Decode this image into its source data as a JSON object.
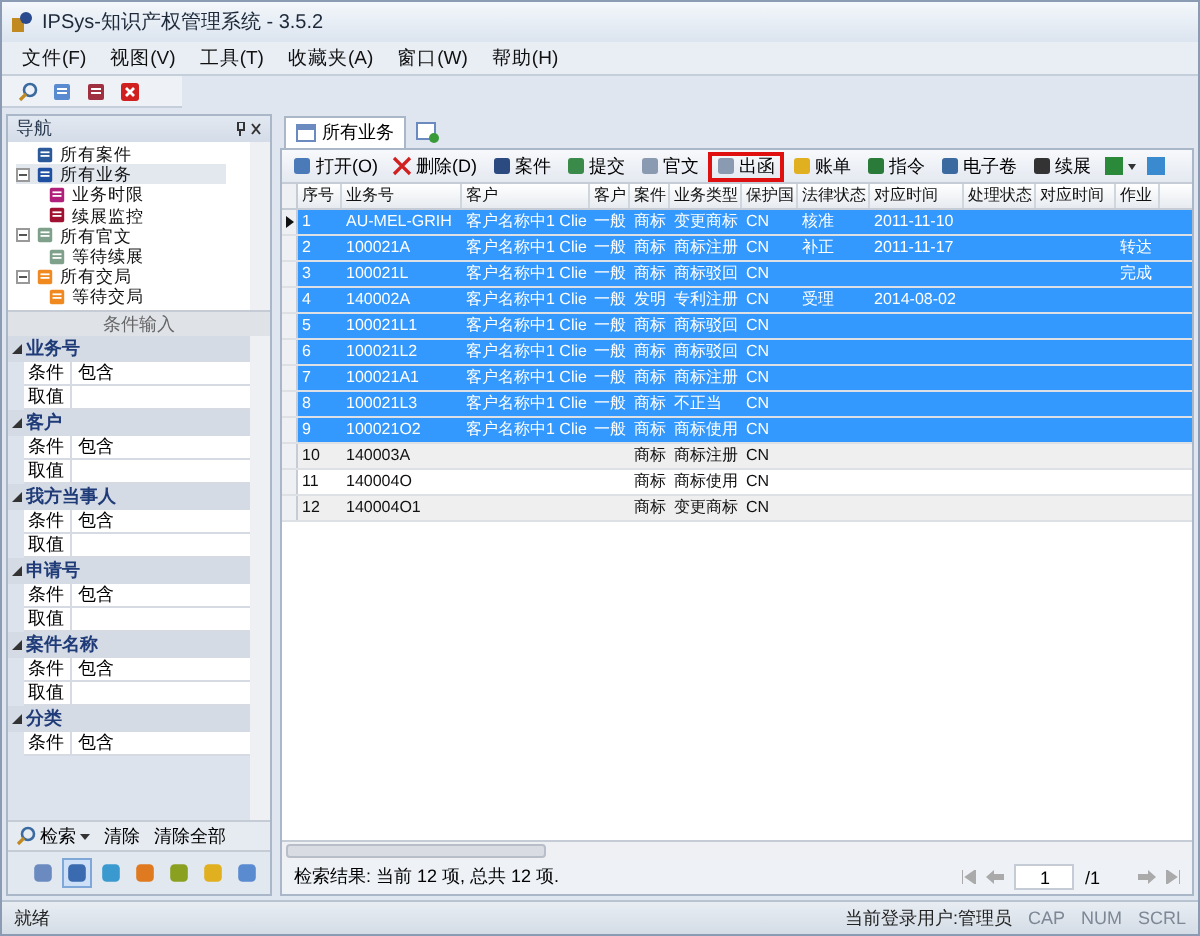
{
  "window": {
    "title": "IPSys-知识产权管理系统 - 3.5.2"
  },
  "menu": [
    "文件(F)",
    "视图(V)",
    "工具(T)",
    "收藏夹(A)",
    "窗口(W)",
    "帮助(H)"
  ],
  "navigation": {
    "title": "导航",
    "tree": [
      {
        "label": "所有案件",
        "selected": false
      },
      {
        "label": "所有业务",
        "selected": true,
        "expanded": true,
        "children": [
          {
            "label": "业务时限",
            "selected": false
          },
          {
            "label": "续展监控",
            "selected": false
          }
        ]
      },
      {
        "label": "所有官文",
        "selected": false,
        "expanded": true,
        "children": [
          {
            "label": "等待续展",
            "selected": false
          }
        ]
      },
      {
        "label": "所有交局",
        "selected": false,
        "expanded": true,
        "children": [
          {
            "label": "等待交局",
            "selected": false
          }
        ]
      }
    ]
  },
  "conditions": {
    "title": "条件输入",
    "groups": [
      {
        "name": "业务号",
        "expanded": true,
        "rows": [
          {
            "label": "条件",
            "value": "包含"
          },
          {
            "label": "取值"
          }
        ]
      },
      {
        "name": "客户",
        "expanded": true,
        "rows": [
          {
            "label": "条件",
            "value": "包含"
          },
          {
            "label": "取值"
          }
        ]
      },
      {
        "name": "我方当事人",
        "expanded": true,
        "rows": [
          {
            "label": "条件",
            "value": "包含"
          },
          {
            "label": "取值"
          }
        ]
      },
      {
        "name": "申请号",
        "expanded": true,
        "rows": [
          {
            "label": "条件",
            "value": "包含"
          },
          {
            "label": "取值"
          }
        ]
      },
      {
        "name": "案件名称",
        "expanded": true,
        "rows": [
          {
            "label": "条件",
            "value": "包含"
          },
          {
            "label": "取值"
          }
        ]
      },
      {
        "name": "分类",
        "expanded": true,
        "rows": [
          {
            "label": "条件",
            "value": "包含"
          }
        ]
      }
    ],
    "actions": [
      "检索",
      "清除",
      "清除全部"
    ]
  },
  "nav_buttons": [
    {
      "selected": false
    },
    {
      "selected": true
    },
    {
      "selected": false
    },
    {
      "selected": false
    },
    {
      "selected": false
    },
    {
      "selected": false
    },
    {
      "selected": false
    }
  ],
  "tabs": [
    {
      "label": "所有业务",
      "selected": true
    }
  ],
  "toolbar": [
    {
      "label": "打开(O)",
      "highlighted": false
    },
    {
      "label": "删除(D)",
      "highlighted": false
    },
    {
      "label": "案件",
      "highlighted": false
    },
    {
      "label": "提交",
      "highlighted": false
    },
    {
      "label": "官文",
      "highlighted": false
    },
    {
      "label": "出函",
      "highlighted": true
    },
    {
      "label": "账单",
      "highlighted": false
    },
    {
      "label": "指令",
      "highlighted": false
    },
    {
      "label": "电子卷",
      "highlighted": false
    },
    {
      "label": "续展",
      "highlighted": false
    }
  ],
  "table": {
    "columns": [
      "序号",
      "业务号",
      "客户",
      "客户",
      "案件",
      "业务类型",
      "保护国",
      "法律状态",
      "对应时间",
      "处理状态",
      "对应时间",
      "作业"
    ],
    "rows": [
      {
        "cells": [
          "1",
          "AU-MEL-GRIH",
          "客户名称中1 Clie",
          "一般",
          "商标",
          "变更商标",
          "CN",
          "核准",
          "2011-11-10",
          "",
          "",
          ""
        ],
        "selected": true,
        "current": true
      },
      {
        "cells": [
          "2",
          "100021A",
          "客户名称中1 Clie",
          "一般",
          "商标",
          "商标注册",
          "CN",
          "补正",
          "2011-11-17",
          "",
          "",
          "转达"
        ],
        "selected": true,
        "current": false
      },
      {
        "cells": [
          "3",
          "100021L",
          "客户名称中1 Clie",
          "一般",
          "商标",
          "商标驳回",
          "CN",
          "",
          "",
          "",
          "",
          "完成"
        ],
        "selected": true,
        "current": false
      },
      {
        "cells": [
          "4",
          "140002A",
          "客户名称中1 Clie",
          "一般",
          "发明",
          "专利注册",
          "CN",
          "受理",
          "2014-08-02",
          "",
          "",
          ""
        ],
        "selected": true,
        "current": false
      },
      {
        "cells": [
          "5",
          "100021L1",
          "客户名称中1 Clie",
          "一般",
          "商标",
          "商标驳回",
          "CN",
          "",
          "",
          "",
          "",
          ""
        ],
        "selected": true,
        "current": false
      },
      {
        "cells": [
          "6",
          "100021L2",
          "客户名称中1 Clie",
          "一般",
          "商标",
          "商标驳回",
          "CN",
          "",
          "",
          "",
          "",
          ""
        ],
        "selected": true,
        "current": false
      },
      {
        "cells": [
          "7",
          "100021A1",
          "客户名称中1 Clie",
          "一般",
          "商标",
          "商标注册",
          "CN",
          "",
          "",
          "",
          "",
          ""
        ],
        "selected": true,
        "current": false
      },
      {
        "cells": [
          "8",
          "100021L3",
          "客户名称中1 Clie",
          "一般",
          "商标",
          "不正当",
          "CN",
          "",
          "",
          "",
          "",
          ""
        ],
        "selected": true,
        "current": false
      },
      {
        "cells": [
          "9",
          "100021O2",
          "客户名称中1 Clie",
          "一般",
          "商标",
          "商标使用",
          "CN",
          "",
          "",
          "",
          "",
          ""
        ],
        "selected": true,
        "current": false
      },
      {
        "cells": [
          "10",
          "140003A",
          "",
          "",
          "商标",
          "商标注册",
          "CN",
          "",
          "",
          "",
          "",
          ""
        ],
        "selected": false,
        "current": false
      },
      {
        "cells": [
          "11",
          "140004O",
          "",
          "",
          "商标",
          "商标使用",
          "CN",
          "",
          "",
          "",
          "",
          ""
        ],
        "selected": false,
        "current": false
      },
      {
        "cells": [
          "12",
          "140004O1",
          "",
          "",
          "商标",
          "变更商标",
          "CN",
          "",
          "",
          "",
          "",
          ""
        ],
        "selected": false,
        "current": false
      }
    ]
  },
  "result": "检索结果: 当前 12 项, 总共 12 项.",
  "pager": {
    "page": "1",
    "total": "/1"
  },
  "status_bar": {
    "text": "就绪",
    "user": "当前登录用户:管理员",
    "indicators": [
      {
        "label": "CAP",
        "on": false
      },
      {
        "label": "NUM",
        "on": false
      },
      {
        "label": "SCRL",
        "on": false
      }
    ]
  }
}
